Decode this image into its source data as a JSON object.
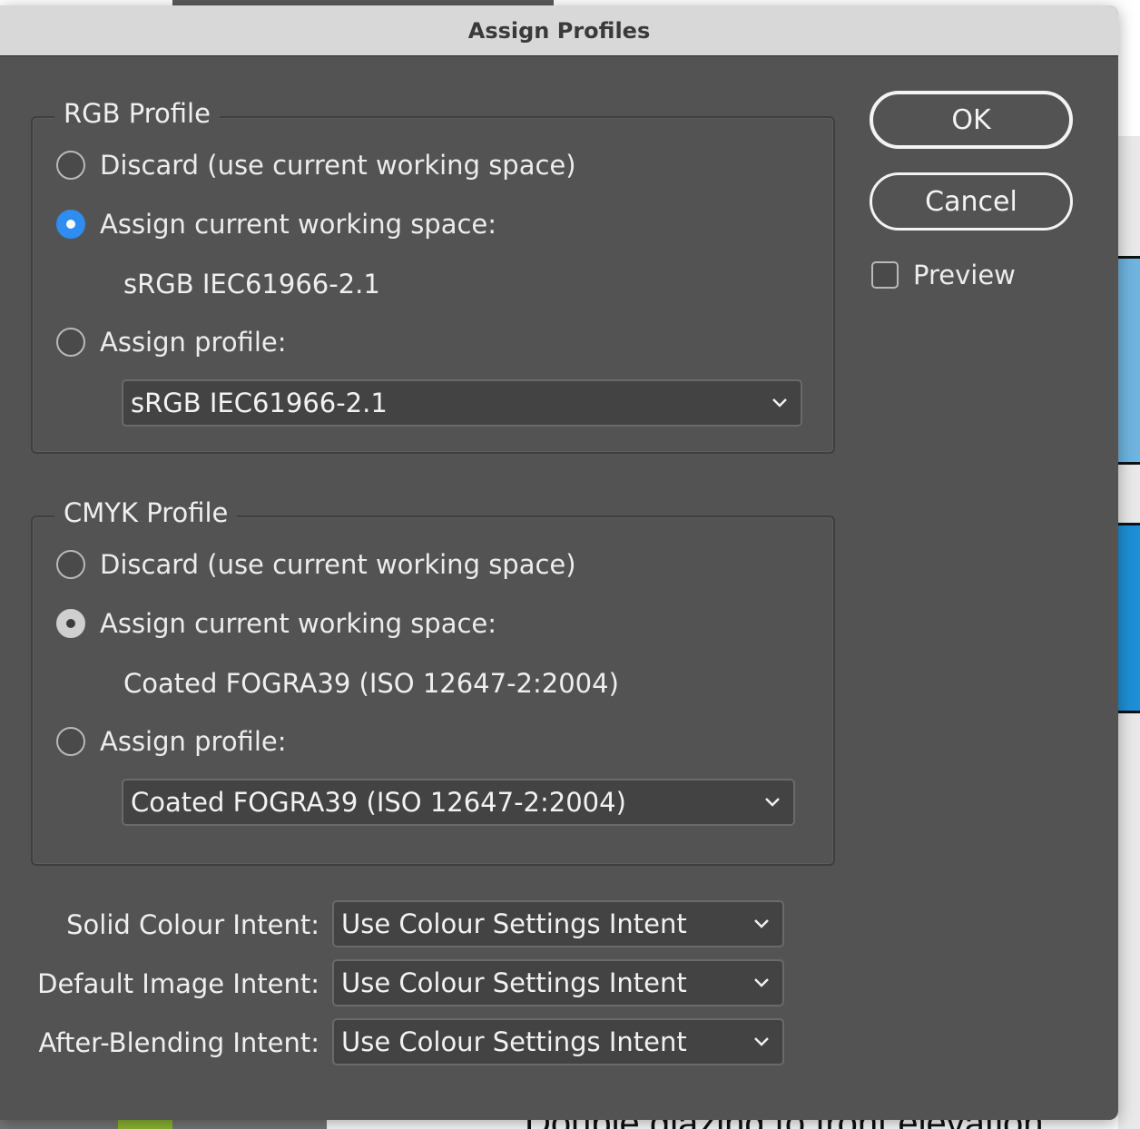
{
  "background": {
    "doc_text": "Double glazing to front elevation"
  },
  "dialog": {
    "title": "Assign Profiles",
    "rgb_profile": {
      "legend": "RGB Profile",
      "discard_label": "Discard (use current working space)",
      "assign_current_label": "Assign current working space:",
      "current_space": "sRGB IEC61966-2.1",
      "assign_profile_label": "Assign profile:",
      "profile_select_value": "sRGB IEC61966-2.1",
      "selected": "assign_current"
    },
    "cmyk_profile": {
      "legend": "CMYK Profile",
      "discard_label": "Discard (use current working space)",
      "assign_current_label": "Assign current working space:",
      "current_space": "Coated FOGRA39 (ISO 12647-2:2004)",
      "assign_profile_label": "Assign profile:",
      "profile_select_value": "Coated FOGRA39 (ISO 12647-2:2004)",
      "selected": "assign_current"
    },
    "intents": [
      {
        "label": "Solid Colour Intent:",
        "value": "Use Colour Settings Intent"
      },
      {
        "label": "Default Image Intent:",
        "value": "Use Colour Settings Intent"
      },
      {
        "label": "After-Blending Intent:",
        "value": "Use Colour Settings Intent"
      }
    ],
    "buttons": {
      "ok": "OK",
      "cancel": "Cancel"
    },
    "preview": {
      "label": "Preview",
      "checked": false
    }
  },
  "colors": {
    "dialog_bg": "#535353",
    "titlebar_bg": "#d8d8d8",
    "radio_selected_accent": "#2f8cf0"
  },
  "icons": {
    "dropdown": "chevron-down-icon"
  }
}
